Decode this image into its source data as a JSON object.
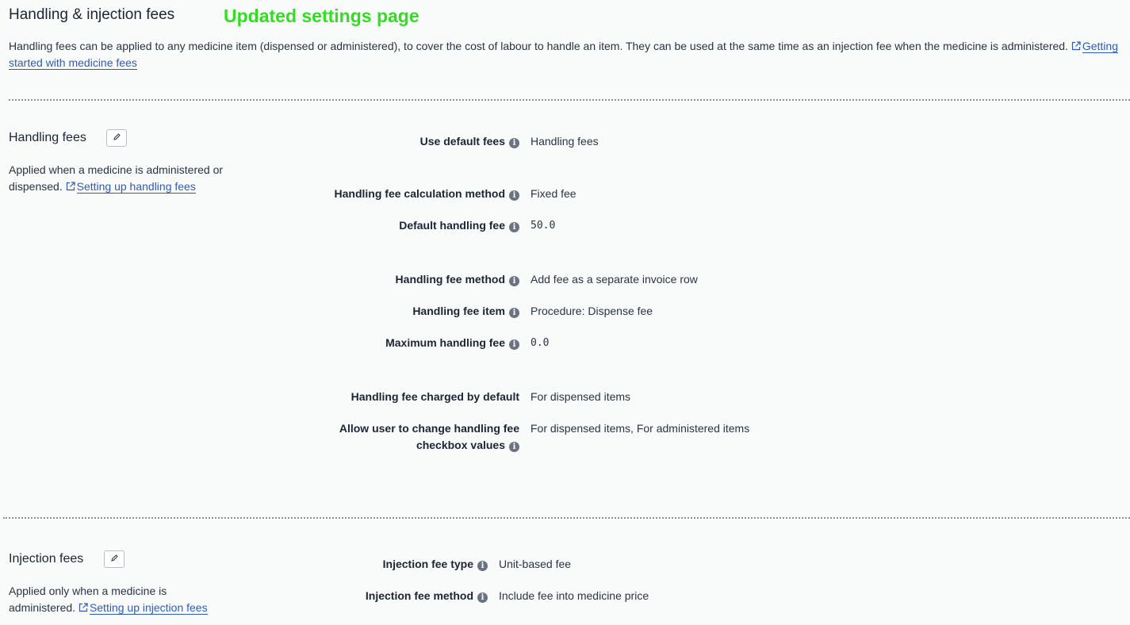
{
  "page": {
    "title": "Handling & injection fees",
    "annotation": "Updated settings page",
    "intro": "Handling fees can be applied to any medicine item (dispensed or administered), to cover the cost of labour to handle an item. They can be used at the same time as an injection fee when the medicine is administered.",
    "intro_link": "Getting started with medicine fees"
  },
  "handling": {
    "title": "Handling fees",
    "desc": "Applied when a medicine is administered or dispensed.",
    "link": "Setting up handling fees",
    "fields": [
      {
        "label": "Use default fees",
        "value": "Handling fees"
      },
      {
        "label": "Handling fee calculation method",
        "value": "Fixed fee"
      },
      {
        "label": "Default handling fee",
        "value": "50.0"
      },
      {
        "label": "Handling fee method",
        "value": "Add fee as a separate invoice row"
      },
      {
        "label": "Handling fee item",
        "value": "Procedure: Dispense fee"
      },
      {
        "label": "Maximum handling fee",
        "value": "0.0"
      },
      {
        "label": "Handling fee charged by default",
        "value": "For dispensed items"
      },
      {
        "label_line1": "Allow user to change handling fee",
        "label_line2": "checkbox values",
        "value": "For dispensed items, For administered items"
      }
    ]
  },
  "injection": {
    "title": "Injection fees",
    "desc": "Applied only when a medicine is administered.",
    "link": "Setting up injection fees",
    "fields": [
      {
        "label": "Injection fee type",
        "value": "Unit-based fee"
      },
      {
        "label": "Injection fee method",
        "value": "Include fee into medicine price"
      }
    ]
  },
  "icons": {
    "edit": "pencil-icon",
    "info": "info-icon",
    "external": "external-link-icon"
  }
}
